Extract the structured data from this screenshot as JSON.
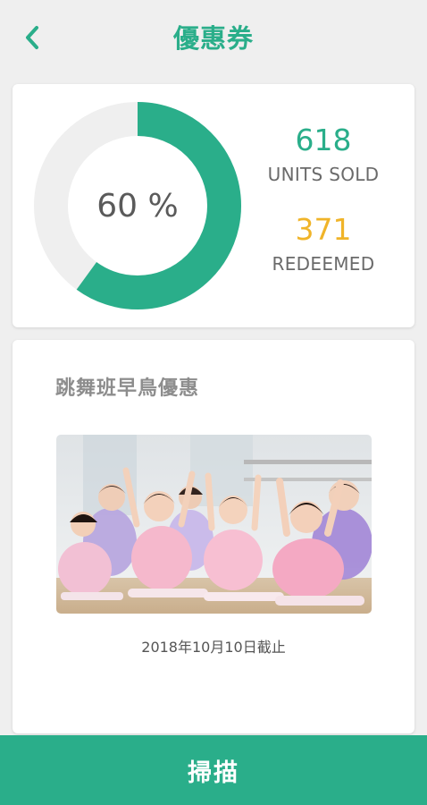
{
  "header": {
    "title": "優惠券",
    "back_icon": "chevron-left-icon"
  },
  "stats": {
    "progress_percent": 60,
    "progress_label": "60 %",
    "units_sold_value": "618",
    "units_sold_label": "UNITS SOLD",
    "redeemed_value": "371",
    "redeemed_label": "REDEEMED"
  },
  "coupon": {
    "title": "跳舞班早鳥優惠",
    "expiry": "2018年10月10日截止"
  },
  "footer": {
    "scan_label": "掃描"
  },
  "colors": {
    "accent": "#2aae8a",
    "redeemed": "#f0b429",
    "ring_track": "#efefef"
  }
}
